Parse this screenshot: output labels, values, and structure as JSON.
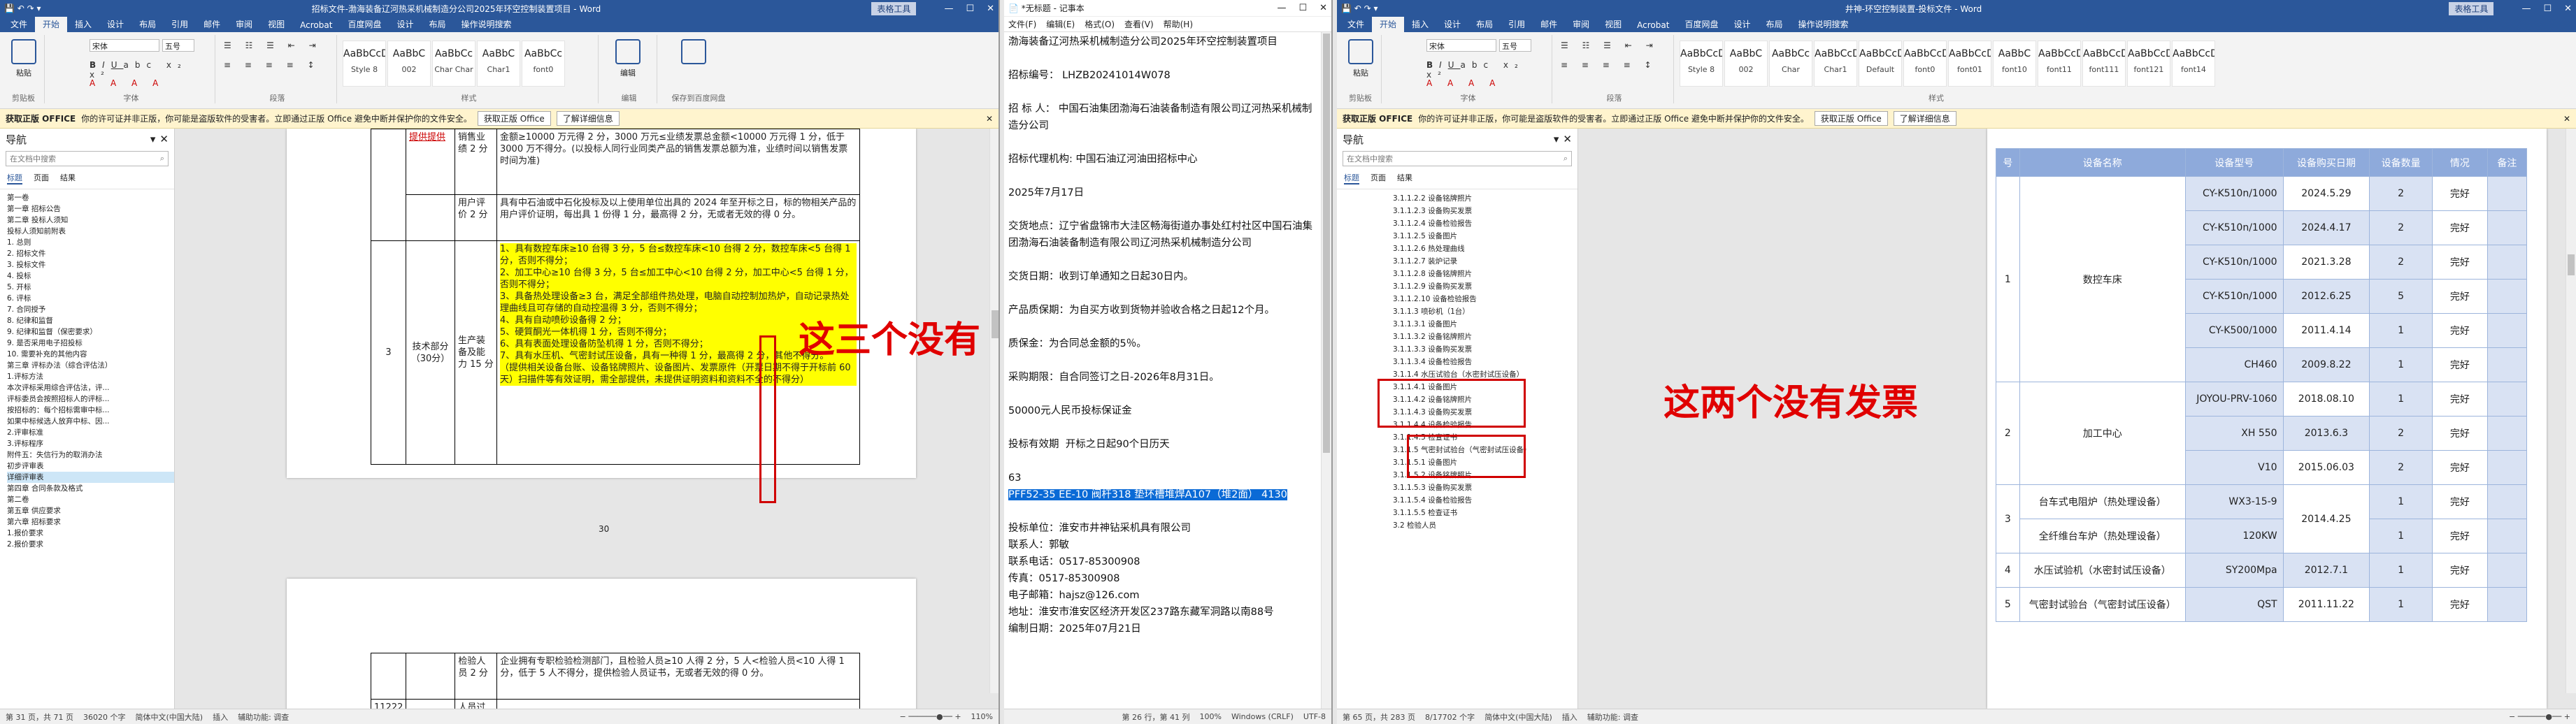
{
  "w1": {
    "title": "招标文件-渤海装备辽河热采机械制造分公司2025年环空控制装置项目 - Word",
    "context_tab": "表格工具",
    "tabs": [
      "文件",
      "开始",
      "插入",
      "设计",
      "布局",
      "引用",
      "邮件",
      "审阅",
      "视图",
      "Acrobat",
      "百度网盘",
      "设计",
      "布局",
      "操作说明搜索"
    ],
    "font_name": "宋体",
    "font_size": "五号",
    "styles": [
      {
        "pv": "AaBbCcDc",
        "nm": "Style 8"
      },
      {
        "pv": "AaBbC",
        "nm": "002"
      },
      {
        "pv": "AaBbCc",
        "nm": "Char Char"
      },
      {
        "pv": "AaBbC",
        "nm": "Char1"
      },
      {
        "pv": "AaBbCc",
        "nm": "font0"
      }
    ],
    "groups": [
      "剪贴板",
      "字体",
      "段落",
      "样式",
      "编辑",
      "保存到百度网盘"
    ],
    "notice": {
      "label": "获取正版 OFFICE",
      "text": "你的许可证并非正版，你可能是盗版软件的受害者。立即通过正版 Office 避免中断并保护你的文件安全。",
      "btn1": "获取正版 Office",
      "btn2": "了解详细信息"
    },
    "nav": {
      "title": "导航",
      "search": "在文档中搜索",
      "tabs": [
        "标题",
        "页面",
        "结果"
      ],
      "items": [
        "第一卷",
        "第一章 招标公告",
        "第二章 投标人须知",
        "投标人须知前附表",
        "1. 总则",
        "2. 招标文件",
        "3. 投标文件",
        "4. 投标",
        "5. 开标",
        "6. 评标",
        "7. 合同授予",
        "8. 纪律和监督",
        "9. 纪律和监督（保密要求）",
        "9. 是否采用电子招投标",
        "10. 需要补充的其他内容",
        "第三章 评标办法（综合评估法）",
        "1.评标方法",
        "本次评标采用综合评估法，评...",
        "评标委员会按照招标人的评标...",
        "按招标的：每个招标需审中标...",
        "如果中标候选人放弃中标、因...",
        "2.评审标准",
        "3.评标程序",
        "附件五：失信行为的取消办法",
        "初步评审表",
        "详细评审表",
        "第四章 合同条款及格式",
        "第二卷",
        "第五章 供应要求",
        "第六章 招标要求",
        "1.报价要求",
        "2.报价要求"
      ],
      "selected": 25
    },
    "table": {
      "r1": {
        "c2": "提供提供",
        "c3": "销售业绩 2 分",
        "c4": "金额≥10000 万元得 2 分，3000 万元≤业绩发票总金额<10000 万元得 1 分，低于 3000 万不得分。(以投标人同行业同类产品的销售发票总额为准，业绩时间以销售发票时间为准)"
      },
      "r2": {
        "c3": "用户评价 2 分",
        "c4": "具有中石油或中石化投标及以上使用单位出具的 2024 年至开标之日，标的物相关产品的用户评价证明，每出具 1 份得 1 分，最高得 2 分，无或者无效的得 0 分。"
      },
      "r3": {
        "c1": "3",
        "c2": "技术部分（30分）",
        "c3": "生产装备及能力 15 分",
        "items": [
          "1、具有数控车床≥10 台得 3 分，5 台≤数控车床<10 台得 2 分，数控车床<5 台得 1 分，否则不得分；",
          "2、加工中心≥10 台得 3 分，5 台≤加工中心<10 台得 2 分，加工中心<5 台得 1 分，否则不得分；",
          "3、具备热处理设备≥3 台，满足全部组件热处理，电脑自动控制加热炉，自动记录热处理曲线且可存储的自动控温得 3 分，否则不得分；",
          "4、具有自动喷砂设备得 2 分；",
          "5、硬質酮光一体机得 1 分，否则不得分；",
          "6、具有表面处理设备防坠机得 1 分，否则不得分；",
          "7、具有水压机、气密封试压设备，具有一种得 1 分，最高得 2 分，其他不得分。",
          "（提供相关设备台账、设备铭牌照片、设备图片、发票原件（开票日期不得于开标前 60 天）扫描件等有效证明，需全部提供，未提供证明资料和资料不全的不得分）"
        ]
      },
      "page_num": "30",
      "r4": {
        "c3": "检验人员 2 分",
        "c4": "企业拥有专职检验检测部门，且检验人员≥10 人得 2 分，5 人<检验人员<10 人得 1 分，低于 5 人不得分，提供检验人员证书，无或者无效的得 0 分。"
      },
      "r5": {
        "c1": "11222",
        "c3": "人员过"
      }
    },
    "annotation": "这三个没有",
    "status": [
      "第 31 页，共 71 页",
      "36020 个字",
      "简体中文(中国大陆)",
      "插入",
      "辅助功能: 调查",
      "110%"
    ]
  },
  "w2": {
    "title": "*无标题 - 记事本",
    "menu": [
      "文件(F)",
      "编辑(E)",
      "格式(O)",
      "查看(V)",
      "帮助(H)"
    ],
    "lines": [
      "渤海装备辽河热采机械制造分公司2025年环空控制装置项目",
      "",
      "招标编号： LHZB20241014W078",
      "",
      "招 标 人： 中国石油集团渤海石油装备制造有限公司辽河热采机械制造分公司",
      "",
      "招标代理机构: 中国石油辽河油田招标中心",
      "",
      "2025年7月17日",
      "",
      "交货地点：辽宁省盘锦市大洼区畅海街道办事处红村社区中国石油集团渤海石油装备制造有限公司辽河热采机械制造分公司",
      "",
      "交货日期：收到订单通知之日起30日内。",
      "",
      "产品质保期：为自买方收到货物并验收合格之日起12个月。",
      "",
      "质保金：为合同总金额的5％。",
      "",
      "采购期限：自合同签订之日-2026年8月31日。",
      "",
      "50000元人民币投标保证金",
      "",
      "投标有效期  开标之日起90个日历天",
      "",
      "63"
    ],
    "selected_line": "PFF52-35 EE-10 阀杆318 垫环槽堆焊A107（堆2面） 4130",
    "lines2": [
      "",
      "投标单位：淮安市井神钻采机具有限公司",
      "联系人：郭敏",
      "联系电话：0517-85300908",
      "传真：0517-85300908",
      "电子邮箱：hajsz@126.com",
      "地址：淮安市淮安区经济开发区237路东藏军洞路以南88号",
      "编制日期：2025年07月21日"
    ],
    "status": [
      "第 26 行，第 41 列",
      "100%",
      "Windows (CRLF)",
      "UTF-8"
    ]
  },
  "w3": {
    "title": "井神-环空控制装置-投标文件 - Word",
    "context_tab": "表格工具",
    "tabs": [
      "文件",
      "开始",
      "插入",
      "设计",
      "布局",
      "引用",
      "邮件",
      "审阅",
      "视图",
      "Acrobat",
      "百度网盘",
      "设计",
      "布局",
      "操作说明搜索"
    ],
    "font_name": "宋体",
    "font_size": "五号",
    "styles": [
      {
        "pv": "AaBbCcDc",
        "nm": "Style 8"
      },
      {
        "pv": "AaBbC",
        "nm": "002"
      },
      {
        "pv": "AaBbCc",
        "nm": "Char"
      },
      {
        "pv": "AaBbCcD",
        "nm": "Char1"
      },
      {
        "pv": "AaBbCcD",
        "nm": "Default"
      },
      {
        "pv": "AaBbCcD",
        "nm": "font0"
      },
      {
        "pv": "AaBbCcD",
        "nm": "font01"
      },
      {
        "pv": "AaBbC",
        "nm": "font10"
      },
      {
        "pv": "AaBbCcD",
        "nm": "font11"
      },
      {
        "pv": "AaBbCcD",
        "nm": "font111"
      },
      {
        "pv": "AaBbCcD",
        "nm": "font121"
      },
      {
        "pv": "AaBbCcD",
        "nm": "font14"
      }
    ],
    "groups": [
      "剪贴板",
      "字体",
      "段落",
      "样式"
    ],
    "notice": {
      "label": "获取正版 OFFICE",
      "text": "你的许可证并非正版，你可能是盗版软件的受害者。立即通过正版 Office 避免中断并保护你的文件安全。",
      "btn1": "获取正版 Office",
      "btn2": "了解详细信息"
    },
    "nav": {
      "title": "导航",
      "search": "在文档中搜索",
      "tabs": [
        "标题",
        "页面",
        "结果"
      ],
      "items": [
        "3.1.1.2.2 设备铭牌照片",
        "3.1.1.2.3 设备购买发票",
        "3.1.1.2.4 设备检验报告",
        "3.1.1.2.5 设备图片",
        "3.1.1.2.6 热处理曲线",
        "3.1.1.2.7 装炉记录",
        "3.1.1.2.8 设备铭牌照片",
        "3.1.1.2.9 设备购买发票",
        "3.1.1.2.10 设备检验报告",
        "3.1.1.3 喷砂机（1台）",
        "3.1.1.3.1 设备图片",
        "3.1.1.3.2 设备铭牌照片",
        "3.1.1.3.3 设备购买发票",
        "3.1.1.3.4 设备检验报告",
        "3.1.1.4 水压试验台（水密封试压设备）",
        "3.1.1.4.1 设备图片",
        "3.1.1.4.2 设备铭牌照片",
        "3.1.1.4.3 设备购买发票",
        "3.1.1.4.4 设备检验报告",
        "3.1.1.4.5 检查证书",
        "3.1.1.5 气密封试验台（气密封试压设备）",
        "3.1.1.5.1 设备图片",
        "3.1.1.5.2 设备铭牌照片",
        "3.1.1.5.3 设备购买发票",
        "3.1.1.5.4 设备检验报告",
        "3.1.1.5.5 检查证书",
        "3.2 检验人员"
      ]
    },
    "annotation": "这两个没有发票",
    "table": {
      "headers": [
        "号",
        "设备名称",
        "设备型号",
        "设备购买日期",
        "设备数量",
        "情况",
        "备注"
      ],
      "rows": [
        {
          "model": "CY-K510n/1000",
          "date": "2024.5.29",
          "qty": "2",
          "state": "完好"
        },
        {
          "model": "CY-K510n/1000",
          "date": "2024.4.17",
          "qty": "2",
          "state": "完好"
        },
        {
          "model": "CY-K510n/1000",
          "date": "2021.3.28",
          "qty": "2",
          "state": "完好"
        },
        {
          "model": "CY-K510n/1000",
          "date": "2012.6.25",
          "qty": "5",
          "state": "完好"
        },
        {
          "model": "CY-K500/1000",
          "date": "2011.4.14",
          "qty": "1",
          "state": "完好"
        },
        {
          "model": "CH460",
          "date": "2009.8.22",
          "qty": "1",
          "state": "完好"
        },
        {
          "model": "JOYOU-PRV-1060",
          "date": "2018.08.10",
          "qty": "1",
          "state": "完好"
        },
        {
          "model": "XH 550",
          "date": "2013.6.3",
          "qty": "2",
          "state": "完好"
        },
        {
          "model": "V10",
          "date": "2015.06.03",
          "qty": "2",
          "state": "完好"
        },
        {
          "model": "WX3-15-9",
          "date": "2014.4.25",
          "qty": "1",
          "state": "完好"
        },
        {
          "model": "120KW",
          "date": "",
          "qty": "1",
          "state": "完好"
        },
        {
          "model": "SY200Mpa",
          "date": "2012.7.1",
          "qty": "1",
          "state": "完好"
        },
        {
          "model": "QST",
          "date": "2011.11.22",
          "qty": "1",
          "state": "完好"
        }
      ],
      "groups": [
        {
          "no": "1",
          "name": "数控车床"
        },
        {
          "no": "2",
          "name": "加工中心"
        },
        {
          "no": "3",
          "name1": "台车式电阻炉（热处理设备）",
          "name2": "全纤维台车炉（热处理设备）"
        },
        {
          "no": "4",
          "name": "水压试验机（水密封试压设备）"
        },
        {
          "no": "5",
          "name": "气密封试验台（气密封试压设备）"
        }
      ]
    },
    "status": [
      "第 65 页，共 283 页",
      "8/17702 个字",
      "简体中文(中国大陆)",
      "插入",
      "辅助功能: 调查"
    ]
  }
}
